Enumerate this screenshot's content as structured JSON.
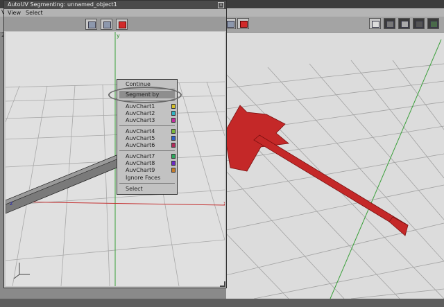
{
  "dialog": {
    "title": "AutoUV Segmenting: unnamed_object1",
    "menu": [
      "View",
      "Select"
    ]
  },
  "background": {
    "menu_letter": "V",
    "viewport_tab": "2"
  },
  "context_menu": {
    "items": [
      "Continue",
      "Segment by",
      "AuvChart1",
      "AuvChart2",
      "AuvChart3",
      "AuvChart4",
      "AuvChart5",
      "AuvChart6",
      "AuvChart7",
      "AuvChart8",
      "AuvChart9",
      "Ignore Faces",
      "Select"
    ],
    "selected": "Segment by",
    "chart_colors": [
      "#d4c02a",
      "#2fb4c4",
      "#c42a9e",
      "#7ab83a",
      "#2e5fc4",
      "#b02a5a",
      "#2fa85e",
      "#6a2ac4",
      "#c47a2a"
    ]
  },
  "axes": {
    "y_label": "y",
    "x_label": "x",
    "z_label": "z"
  },
  "colors": {
    "object_red": "#c42828",
    "grid": "#9a9a9a",
    "y_axis": "#2faa2f",
    "x_axis": "#c43030"
  }
}
